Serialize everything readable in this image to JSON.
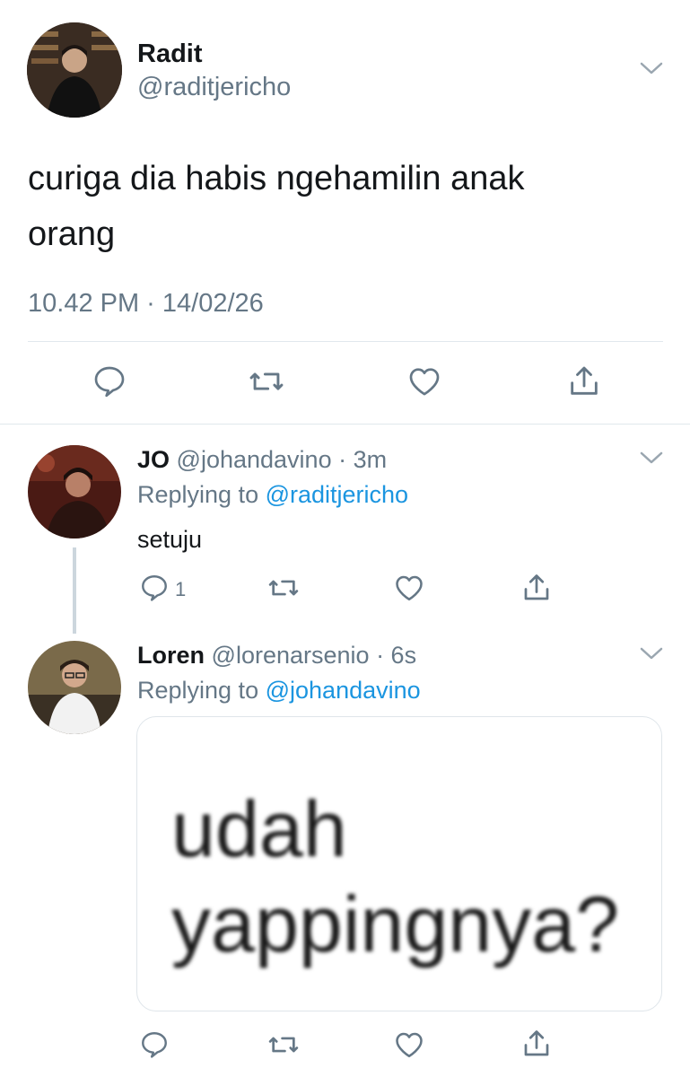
{
  "main_tweet": {
    "name": "Radit",
    "handle": "@raditjericho",
    "text_line1": "curiga dia habis ngehamilin anak",
    "text_line2": "orang",
    "timestamp": "10.42 PM · 14/02/26",
    "actions": [
      "reply-icon",
      "retweet-icon",
      "like-icon",
      "share-icon"
    ]
  },
  "replies": [
    {
      "name": "JO",
      "handle": "@johandavino",
      "time": "· 3m",
      "replying_label": "Replying to",
      "replying_to": "@raditjericho",
      "text": "setuju",
      "reply_count": "1"
    },
    {
      "name": "Loren",
      "handle": "@lorenarsenio",
      "time": "· 6s",
      "replying_label": "Replying to",
      "replying_to": "@johandavino",
      "image_text_line1": "udah",
      "image_text_line2": "yappingnya?"
    }
  ],
  "colors": {
    "text": "#14171a",
    "secondary": "#657786",
    "link": "#1b95e0",
    "divider": "#e1e8ed"
  }
}
